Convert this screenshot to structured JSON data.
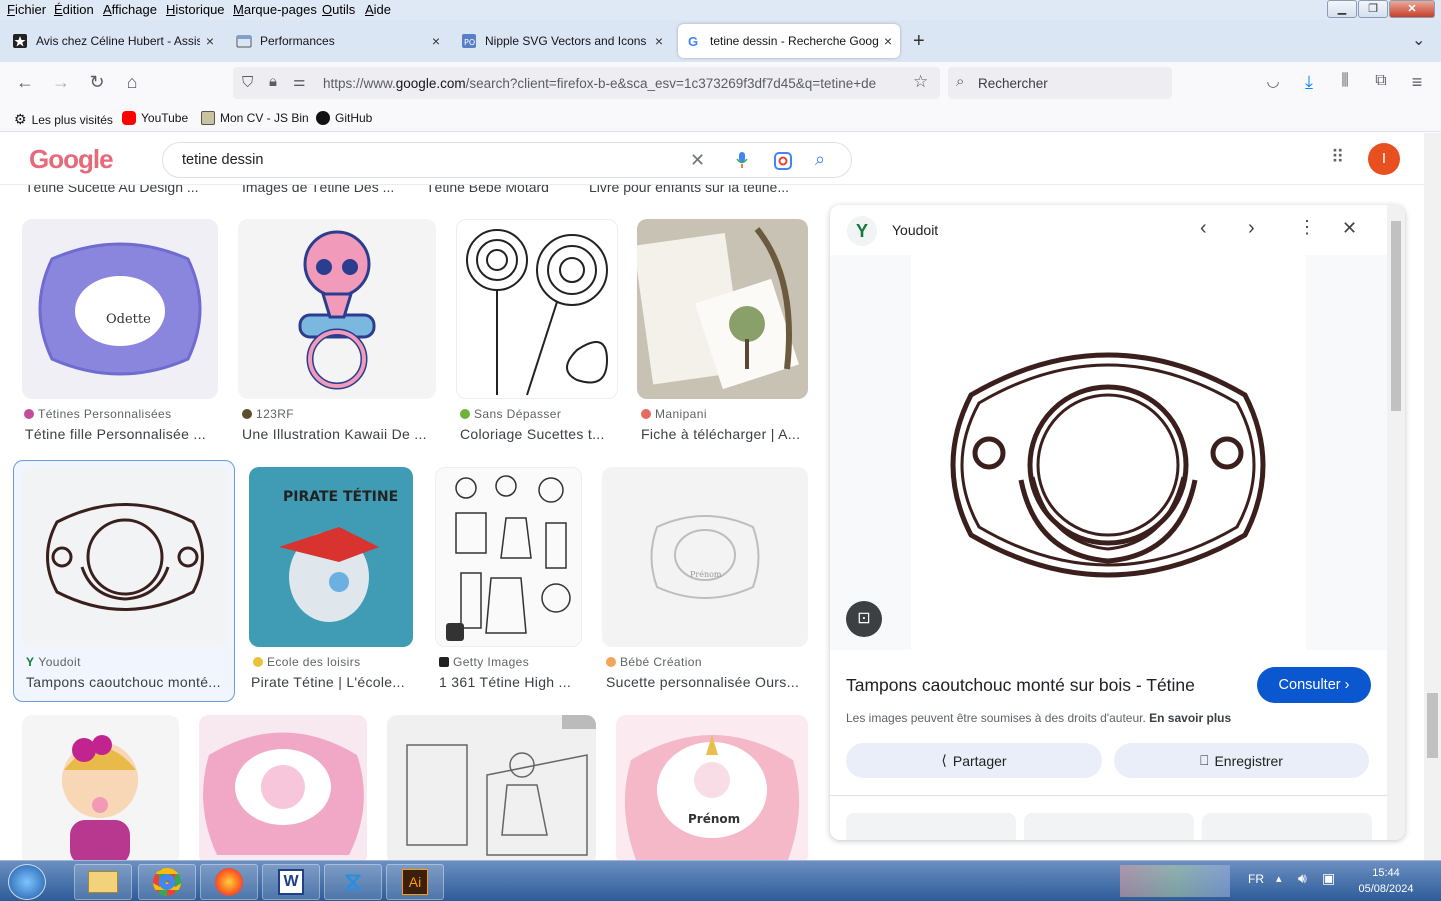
{
  "menubar": {
    "items": [
      "Fichier",
      "Édition",
      "Affichage",
      "Historique",
      "Marque-pages",
      "Outils",
      "Aide"
    ],
    "underline": [
      "F",
      "É",
      "A",
      "H",
      "M",
      "O",
      "A"
    ]
  },
  "tabs": [
    {
      "label": "Avis chez Céline Hubert - Assist",
      "close": "×"
    },
    {
      "label": "Performances",
      "close": "×"
    },
    {
      "label": "Nipple SVG Vectors and Icons -",
      "close": "×"
    },
    {
      "label": "tetine dessin - Recherche Goog",
      "close": "×"
    }
  ],
  "new_tab": "+",
  "url": {
    "prefix": "https://www.",
    "domain": "google.com",
    "rest": "/search?client=firefox-b-e&sca_esv=1c373269f3df7d45&q=tetine+de"
  },
  "browser_search_placeholder": "Rechercher",
  "bookmarks": [
    "Les plus visités",
    "YouTube",
    "Mon CV - JS Bin",
    "GitHub"
  ],
  "google": {
    "query": "tetine dessin",
    "avatar_letter": "I",
    "logo_text": "Google"
  },
  "top_captions": [
    "Tétine Sucette Au Design ...",
    "Images de Tétine Des ...",
    "Tétine Bébé Motard",
    "Livre pour enfants sur la tétine..."
  ],
  "results_row1": [
    {
      "source": "Tétines Personnalisées",
      "title": "Tétine fille Personnalisée ...",
      "label": "Odette"
    },
    {
      "source": "123RF",
      "title": "Une Illustration Kawaii De ..."
    },
    {
      "source": "Sans Dépasser",
      "title": "Coloriage Sucettes t..."
    },
    {
      "source": "Manipani",
      "title": "Fiche à télécharger | A..."
    }
  ],
  "results_row2": [
    {
      "source": "Youdoit",
      "title": "Tampons caoutchouc monté..."
    },
    {
      "source": "Ecole des loisirs",
      "title": "Pirate Tétine | L'école...",
      "cover": "PIRATE TÉTINE"
    },
    {
      "source": "Getty Images",
      "title": "1 361 Tétine High ..."
    },
    {
      "source": "Bébé Création",
      "title": "Sucette personnalisée Ours...",
      "label": "Prénom"
    }
  ],
  "results_row3": [
    {
      "label": ""
    },
    {
      "label": ""
    },
    {
      "label": ""
    },
    {
      "label": "Prénom"
    }
  ],
  "panel": {
    "source": "Youdoit",
    "title": "Tampons caoutchouc monté sur bois - Tétine",
    "consult": "Consulter",
    "note": "Les images peuvent être soumises à des droits d'auteur.",
    "note_link": "En savoir plus",
    "share": "Partager",
    "save": "Enregistrer"
  },
  "taskbar": {
    "lang": "FR",
    "time": "15:44",
    "date": "05/08/2024"
  },
  "colors": {
    "accent": "#0b57d0",
    "selected_border": "#6d9be0",
    "pacifier_stroke": "#3a1f1c"
  }
}
